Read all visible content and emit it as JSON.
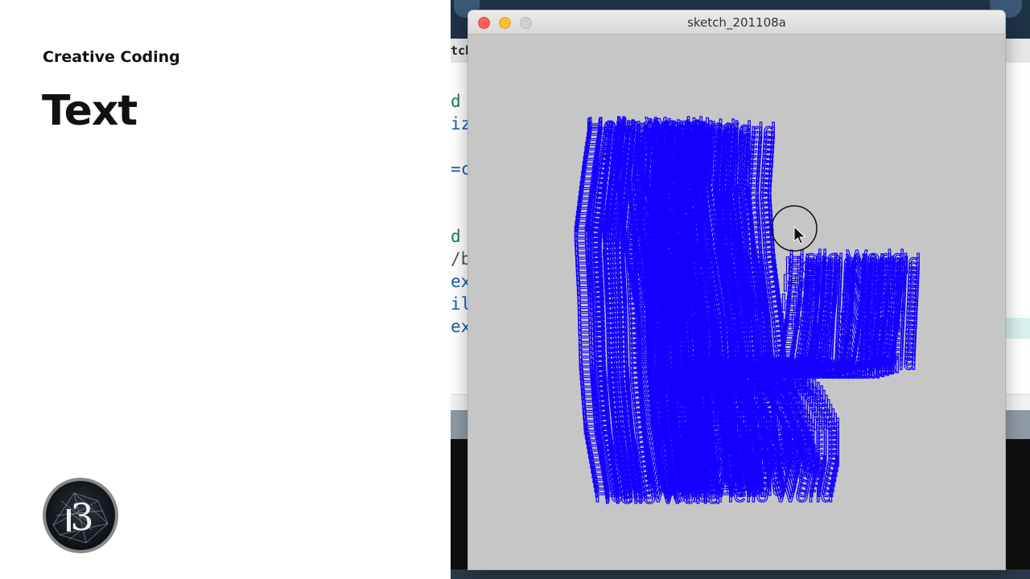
{
  "slide": {
    "course_title": "Creative Coding",
    "title": "Text",
    "logo": "p5-logo"
  },
  "ide": {
    "tab_label": "tch",
    "code_lines": [
      {
        "text": "d",
        "color": "#1a7a5e"
      },
      {
        "text": "iz",
        "color": "#1a5aa8"
      },
      {
        "text": "=c",
        "color": "#1a5aa8"
      },
      {
        "text": "d",
        "color": "#1a7a5e"
      },
      {
        "text": "/b",
        "color": "#555555"
      },
      {
        "text": "ex",
        "color": "#1a5aa8"
      },
      {
        "text": "il",
        "color": "#1a5aa8"
      },
      {
        "text": "ex",
        "color": "#1a5aa8"
      }
    ]
  },
  "sketch": {
    "window_title": "sketch_201108a",
    "text": "Hello World",
    "text_color": "#1400ff",
    "background": "#c6c6c6"
  },
  "cursor": {
    "icon": "pointer-arrow-icon"
  }
}
